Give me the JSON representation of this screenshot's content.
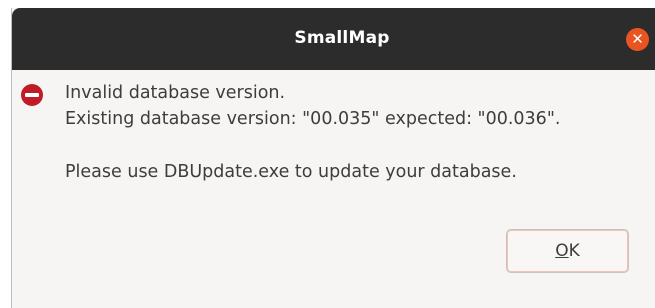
{
  "dialog": {
    "title": "SmallMap",
    "close_icon": "close-icon",
    "status_icon": "error-icon",
    "message_line1": "Invalid database version.",
    "message_line2": "Existing database version: \"00.035\" expected: \"00.036\".",
    "message_line3": "Please use DBUpdate.exe to update your database.",
    "ok_mnemonic": "O",
    "ok_rest": "K",
    "colors": {
      "titlebar": "#2c2c2c",
      "close": "#e95420",
      "error": "#c01c28"
    }
  }
}
